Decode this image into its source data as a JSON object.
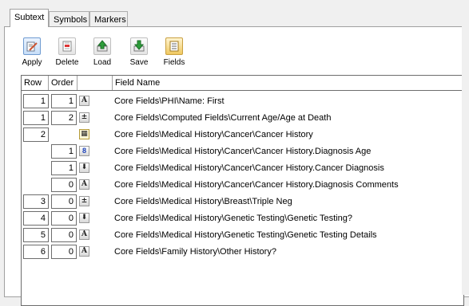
{
  "tabs": [
    {
      "label": "Subtext",
      "active": true
    },
    {
      "label": "Symbols",
      "active": false
    },
    {
      "label": "Markers",
      "active": false
    }
  ],
  "toolbar": {
    "apply": "Apply",
    "delete": "Delete",
    "load": "Load",
    "save": "Save",
    "fields": "Fields"
  },
  "grid": {
    "headers": {
      "row": "Row",
      "order": "Order",
      "type": "",
      "field_name": "Field Name"
    },
    "rows": [
      {
        "row": "1",
        "order": "1",
        "type": "text",
        "field": "Core Fields\\PHI\\Name: First"
      },
      {
        "row": "1",
        "order": "2",
        "type": "computed",
        "field": "Core Fields\\Computed Fields\\Current Age/Age at Death"
      },
      {
        "row": "2",
        "order": "",
        "type": "grid",
        "field": "Core Fields\\Medical History\\Cancer\\Cancer History"
      },
      {
        "row": "",
        "order": "1",
        "type": "number",
        "field": "Core Fields\\Medical History\\Cancer\\Cancer History.Diagnosis Age"
      },
      {
        "row": "",
        "order": "1",
        "type": "dropdown",
        "field": "Core Fields\\Medical History\\Cancer\\Cancer History.Cancer Diagnosis"
      },
      {
        "row": "",
        "order": "0",
        "type": "text",
        "field": "Core Fields\\Medical History\\Cancer\\Cancer History.Diagnosis Comments"
      },
      {
        "row": "3",
        "order": "0",
        "type": "computed",
        "field": "Core Fields\\Medical History\\Breast\\Triple Neg"
      },
      {
        "row": "4",
        "order": "0",
        "type": "dropdown",
        "field": "Core Fields\\Medical History\\Genetic Testing\\Genetic Testing?"
      },
      {
        "row": "5",
        "order": "0",
        "type": "text",
        "field": "Core Fields\\Medical History\\Genetic Testing\\Genetic Testing Details"
      },
      {
        "row": "6",
        "order": "0",
        "type": "text",
        "field": "Core Fields\\Family History\\Other History?"
      }
    ]
  },
  "type_glyphs": {
    "text": "A",
    "number": "8",
    "computed": "±",
    "dropdown": "⬇",
    "grid": "▦"
  },
  "colors": {
    "active_tab": "#ffffff",
    "background": "#f0f0f0",
    "number_icon": "#1a3fb8"
  }
}
